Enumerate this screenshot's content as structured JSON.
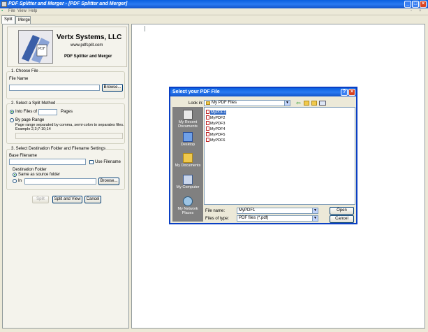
{
  "window": {
    "title": "PDF Splitter and Merger - [PDF Splitter and Merger]"
  },
  "menu": {
    "items": [
      "File",
      "View",
      "Help"
    ]
  },
  "tabs": [
    "Split",
    "Merge"
  ],
  "header": {
    "company": "Vertx Systems, LLC",
    "website": "www.pdfsplit.com",
    "product": "PDF Splitter and Merger",
    "logo_text": "PDF"
  },
  "section1": {
    "legend": "1. Choose File",
    "file_label": "File Name",
    "file_value": "",
    "browse": "Browse..."
  },
  "section2": {
    "legend": "2. Select a Split Method",
    "into_files_label": "Into Files of",
    "pages_value": "",
    "pages_label": "Pages",
    "by_range_label": "By page Range",
    "range_help": "Page range separated by comma, semi-colon to separates files.",
    "range_example": "Example 2,3;7-10;14",
    "range_value": ""
  },
  "section3": {
    "legend": "3. Select Destination Folder and Filename Settings",
    "base_label": "Base Filename",
    "base_value": "",
    "use_filename": "Use Filename",
    "dest_label": "Destination Folder",
    "same_as_source": "Same as source folder",
    "in_label": "In",
    "in_value": "",
    "browse": "Browse..."
  },
  "actions": {
    "split": "Split",
    "split_and_view": "Split and View",
    "cancel": "Cancel"
  },
  "dialog": {
    "title": "Select your PDF File",
    "look_in_label": "Look in:",
    "look_in_value": "My PDF Files",
    "places": [
      "My Recent Documents",
      "Desktop",
      "My Documents",
      "My Computer",
      "My Network Places"
    ],
    "files": [
      "MyPDF1",
      "MyPDF2",
      "MyPDF3",
      "MyPDF4",
      "MyPDF5",
      "MyPDF6"
    ],
    "selected_file": "MyPDF1",
    "file_name_label": "File name:",
    "file_name_value": "MyPDF1",
    "file_type_label": "Files of type:",
    "file_type_value": "PDF files (*.pdf)",
    "open": "Open",
    "cancel": "Cancel"
  },
  "colors": {
    "titlebar": "#0a5fe0",
    "selection": "#316ac5",
    "close": "#d9421f"
  }
}
